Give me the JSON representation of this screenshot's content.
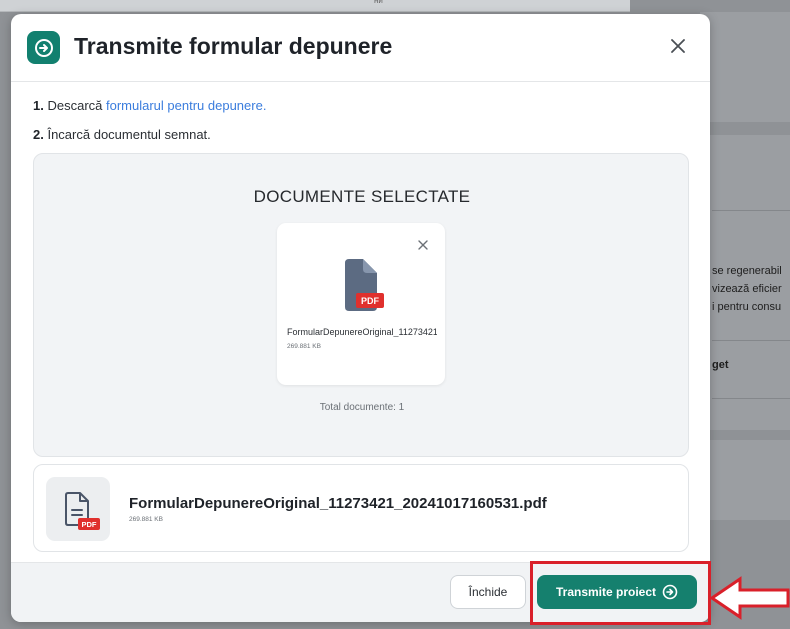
{
  "background": {
    "top_strip_text": "ни",
    "snippets": [
      "se regenerabil",
      "vizează eficier",
      "i pentru consu"
    ],
    "bold_snippet": "get"
  },
  "modal": {
    "title": "Transmite formular depunere",
    "header_icon": "arrow-circle-right-icon",
    "close_icon": "close-icon",
    "step1": {
      "number": "1.",
      "text": "Descarcă ",
      "link": "formularul pentru depunere."
    },
    "step2": {
      "number": "2.",
      "text": "Încarcă documentul semnat."
    },
    "selected": {
      "title": "DOCUMENTE SELECTATE",
      "file_name": "FormularDepunereOriginal_11273421_20241017160531.pdf",
      "file_size": "269.881 KB",
      "badge": "PDF",
      "total": "Total documente: 1"
    },
    "uploaded": {
      "file_name": "FormularDepunereOriginal_11273421_20241017160531.pdf",
      "file_size": "269.881 KB",
      "badge": "PDF"
    },
    "footer": {
      "close_label": "Închide",
      "submit_label": "Transmite proiect"
    }
  },
  "colors": {
    "accent": "#12806f",
    "link": "#3b7ddd",
    "pdf_badge": "#e0302d",
    "annotation": "#d9202a"
  }
}
